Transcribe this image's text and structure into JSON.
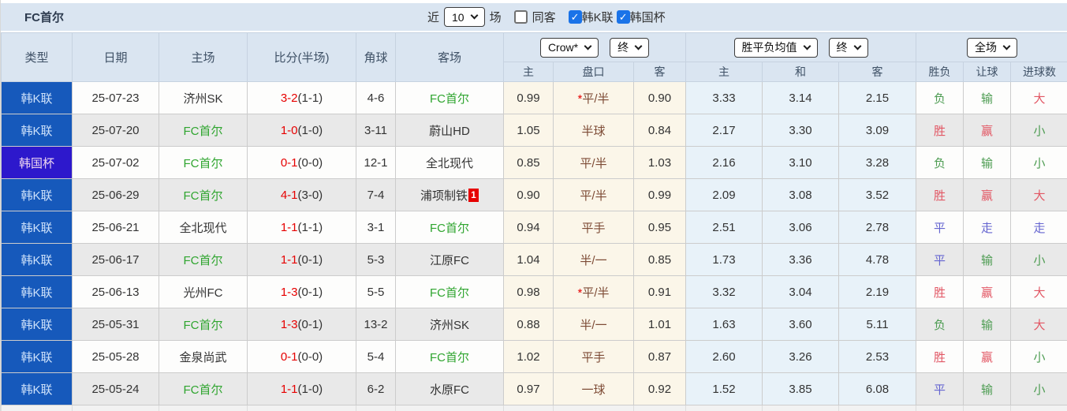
{
  "header": {
    "title": "FC首尔",
    "recent_label": "近",
    "recent_value": "10",
    "matches_label": "场",
    "same_guest_label": "同客",
    "league_label": "韩K联",
    "cup_label": "韩国杯",
    "same_guest_checked": false,
    "league_checked": true,
    "cup_checked": true
  },
  "columns": {
    "type": "类型",
    "date": "日期",
    "home": "主场",
    "score": "比分(半场)",
    "corner": "角球",
    "away": "客场"
  },
  "selects": {
    "company": "Crow*",
    "company_stage": "终",
    "mean": "胜平负均值",
    "mean_stage": "终",
    "scope": "全场"
  },
  "sub_headers": [
    "主",
    "盘口",
    "客",
    "主",
    "和",
    "客",
    "胜负",
    "让球",
    "进球数"
  ],
  "colors": {
    "league_bg": "#1659bb",
    "cup_bg": "#2d18cc",
    "result_red": "#e25764",
    "result_green": "#4d9c52",
    "result_blue": "#6565d0",
    "self_team_green": "#2fa52f",
    "score_red": "#e60000",
    "crow_cell_bg": "#fbf6e9",
    "mean_cell_bg": "#e8f2f9",
    "header_bg": "#dae5f1",
    "checkbox_blue": "#1a73e8"
  },
  "rows": [
    {
      "type": "韩K联",
      "type_kind": "league",
      "date": "25-07-23",
      "home": "济州SK",
      "home_self": false,
      "score": "3-2",
      "half": "(1-1)",
      "corners": "4-6",
      "away": "FC首尔",
      "away_self": true,
      "away_badge": "",
      "star": "*",
      "odds_home": "0.99",
      "handicap": "平/半",
      "odds_away": "0.90",
      "mean_home": "3.33",
      "mean_draw": "3.14",
      "mean_away": "2.15",
      "outcome": {
        "text": "负",
        "color": "green"
      },
      "handicap_result": {
        "text": "输",
        "color": "green"
      },
      "goals": {
        "text": "大",
        "color": "red"
      }
    },
    {
      "type": "韩K联",
      "type_kind": "league",
      "date": "25-07-20",
      "home": "FC首尔",
      "home_self": true,
      "score": "1-0",
      "half": "(1-0)",
      "corners": "3-11",
      "away": "蔚山HD",
      "away_self": false,
      "away_badge": "",
      "star": "",
      "odds_home": "1.05",
      "handicap": "半球",
      "odds_away": "0.84",
      "mean_home": "2.17",
      "mean_draw": "3.30",
      "mean_away": "3.09",
      "outcome": {
        "text": "胜",
        "color": "red"
      },
      "handicap_result": {
        "text": "赢",
        "color": "red"
      },
      "goals": {
        "text": "小",
        "color": "green"
      }
    },
    {
      "type": "韩国杯",
      "type_kind": "cup",
      "date": "25-07-02",
      "home": "FC首尔",
      "home_self": true,
      "score": "0-1",
      "half": "(0-0)",
      "corners": "12-1",
      "away": "全北现代",
      "away_self": false,
      "away_badge": "",
      "star": "",
      "odds_home": "0.85",
      "handicap": "平/半",
      "odds_away": "1.03",
      "mean_home": "2.16",
      "mean_draw": "3.10",
      "mean_away": "3.28",
      "outcome": {
        "text": "负",
        "color": "green"
      },
      "handicap_result": {
        "text": "输",
        "color": "green"
      },
      "goals": {
        "text": "小",
        "color": "green"
      }
    },
    {
      "type": "韩K联",
      "type_kind": "league",
      "date": "25-06-29",
      "home": "FC首尔",
      "home_self": true,
      "score": "4-1",
      "half": "(3-0)",
      "corners": "7-4",
      "away": "浦项制铁",
      "away_self": false,
      "away_badge": "1",
      "star": "",
      "odds_home": "0.90",
      "handicap": "平/半",
      "odds_away": "0.99",
      "mean_home": "2.09",
      "mean_draw": "3.08",
      "mean_away": "3.52",
      "outcome": {
        "text": "胜",
        "color": "red"
      },
      "handicap_result": {
        "text": "赢",
        "color": "red"
      },
      "goals": {
        "text": "大",
        "color": "red"
      }
    },
    {
      "type": "韩K联",
      "type_kind": "league",
      "date": "25-06-21",
      "home": "全北现代",
      "home_self": false,
      "score": "1-1",
      "half": "(1-1)",
      "corners": "3-1",
      "away": "FC首尔",
      "away_self": true,
      "away_badge": "",
      "star": "",
      "odds_home": "0.94",
      "handicap": "平手",
      "odds_away": "0.95",
      "mean_home": "2.51",
      "mean_draw": "3.06",
      "mean_away": "2.78",
      "outcome": {
        "text": "平",
        "color": "blue"
      },
      "handicap_result": {
        "text": "走",
        "color": "blue"
      },
      "goals": {
        "text": "走",
        "color": "blue"
      }
    },
    {
      "type": "韩K联",
      "type_kind": "league",
      "date": "25-06-17",
      "home": "FC首尔",
      "home_self": true,
      "score": "1-1",
      "half": "(0-1)",
      "corners": "5-3",
      "away": "江原FC",
      "away_self": false,
      "away_badge": "",
      "star": "",
      "odds_home": "1.04",
      "handicap": "半/一",
      "odds_away": "0.85",
      "mean_home": "1.73",
      "mean_draw": "3.36",
      "mean_away": "4.78",
      "outcome": {
        "text": "平",
        "color": "blue"
      },
      "handicap_result": {
        "text": "输",
        "color": "green"
      },
      "goals": {
        "text": "小",
        "color": "green"
      }
    },
    {
      "type": "韩K联",
      "type_kind": "league",
      "date": "25-06-13",
      "home": "光州FC",
      "home_self": false,
      "score": "1-3",
      "half": "(0-1)",
      "corners": "5-5",
      "away": "FC首尔",
      "away_self": true,
      "away_badge": "",
      "star": "*",
      "odds_home": "0.98",
      "handicap": "平/半",
      "odds_away": "0.91",
      "mean_home": "3.32",
      "mean_draw": "3.04",
      "mean_away": "2.19",
      "outcome": {
        "text": "胜",
        "color": "red"
      },
      "handicap_result": {
        "text": "赢",
        "color": "red"
      },
      "goals": {
        "text": "大",
        "color": "red"
      }
    },
    {
      "type": "韩K联",
      "type_kind": "league",
      "date": "25-05-31",
      "home": "FC首尔",
      "home_self": true,
      "score": "1-3",
      "half": "(0-1)",
      "corners": "13-2",
      "away": "济州SK",
      "away_self": false,
      "away_badge": "",
      "star": "",
      "odds_home": "0.88",
      "handicap": "半/一",
      "odds_away": "1.01",
      "mean_home": "1.63",
      "mean_draw": "3.60",
      "mean_away": "5.11",
      "outcome": {
        "text": "负",
        "color": "green"
      },
      "handicap_result": {
        "text": "输",
        "color": "green"
      },
      "goals": {
        "text": "大",
        "color": "red"
      }
    },
    {
      "type": "韩K联",
      "type_kind": "league",
      "date": "25-05-28",
      "home": "金泉尚武",
      "home_self": false,
      "score": "0-1",
      "half": "(0-0)",
      "corners": "5-4",
      "away": "FC首尔",
      "away_self": true,
      "away_badge": "",
      "star": "",
      "odds_home": "1.02",
      "handicap": "平手",
      "odds_away": "0.87",
      "mean_home": "2.60",
      "mean_draw": "3.26",
      "mean_away": "2.53",
      "outcome": {
        "text": "胜",
        "color": "red"
      },
      "handicap_result": {
        "text": "赢",
        "color": "red"
      },
      "goals": {
        "text": "小",
        "color": "green"
      }
    },
    {
      "type": "韩K联",
      "type_kind": "league",
      "date": "25-05-24",
      "home": "FC首尔",
      "home_self": true,
      "score": "1-1",
      "half": "(1-0)",
      "corners": "6-2",
      "away": "水原FC",
      "away_self": false,
      "away_badge": "",
      "star": "",
      "odds_home": "0.97",
      "handicap": "一球",
      "odds_away": "0.92",
      "mean_home": "1.52",
      "mean_draw": "3.85",
      "mean_away": "6.08",
      "outcome": {
        "text": "平",
        "color": "blue"
      },
      "handicap_result": {
        "text": "输",
        "color": "green"
      },
      "goals": {
        "text": "小",
        "color": "green"
      }
    }
  ]
}
